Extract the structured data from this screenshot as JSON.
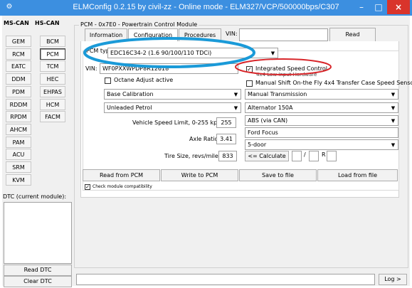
{
  "window": {
    "title": "ELMConfig 0.2.15 by civil-zz - Online mode - ELM327/VCP/500000bps/C307",
    "min_label": "–",
    "max_label": "□",
    "close_label": "×",
    "app_icon": "⚙"
  },
  "left": {
    "tab_ms": "MS-CAN",
    "tab_hs": "HS-CAN",
    "ms_items": [
      "GEM",
      "RCM",
      "EATC",
      "DDM",
      "PDM",
      "RDDM",
      "RPDM",
      "AHCM",
      "PAM",
      "ACU",
      "SRM",
      "KVM"
    ],
    "hs_items": [
      "BCM",
      "PCM",
      "TCM",
      "HEC",
      "EHPAS",
      "HCM",
      "FACM"
    ],
    "dtc_label": "DTC (current module):",
    "read_dtc": "Read DTC",
    "clear_dtc": "Clear DTC"
  },
  "module": {
    "group_title": "PCM - 0x7E0 - Powertrain Control Module",
    "tab_info": "Information",
    "tab_config": "Configuration",
    "tab_proc": "Procedures",
    "vin_label": "VIN:",
    "vin_top_value": "",
    "read_btn": "Read"
  },
  "config": {
    "pcm_type_label": "PCM type:",
    "pcm_type_value": "EDC16C34-2 (1.6 90/100/110 TDCi)",
    "vin_label": "VIN:",
    "vin_value": "WF0PXXWPDP8R12618",
    "integrated_speed": "Integrated Speed Control",
    "integrated_speed_checked": true,
    "low_input_hw": "4x4 Low Input Hardware",
    "manual_shift": "Manual Shift On-the Fly 4x4 Transfer Case Speed Sensor",
    "octane": "Octane Adjust active",
    "calibration": "Base Calibration",
    "transmission": "Manual Transmission",
    "fuel": "Unleaded Petrol",
    "alternator": "Alternator 150A",
    "speed_limit_label": "Vehicle Speed Limit, 0-255 kph",
    "speed_limit_value": "255",
    "abs": "ABS (via CAN)",
    "model": "Ford Focus",
    "axle_label": "Axle Ratio",
    "axle_value": "3.41",
    "body": "5-door",
    "tire_label": "Tire Size, revs/mile",
    "tire_value": "833",
    "calc_btn": "<= Calculate",
    "slash": "/",
    "r_label": "R",
    "read_pcm": "Read from PCM",
    "write_pcm": "Write to PCM",
    "save_file": "Save to file",
    "load_file": "Load from file",
    "check_compat": "Check module compatibility",
    "check_compat_checked": true
  },
  "log": {
    "log_btn": "Log >"
  },
  "annotations": {
    "ellipse_blue": "#1a9ad8",
    "ellipse_red": "#d8262a"
  }
}
